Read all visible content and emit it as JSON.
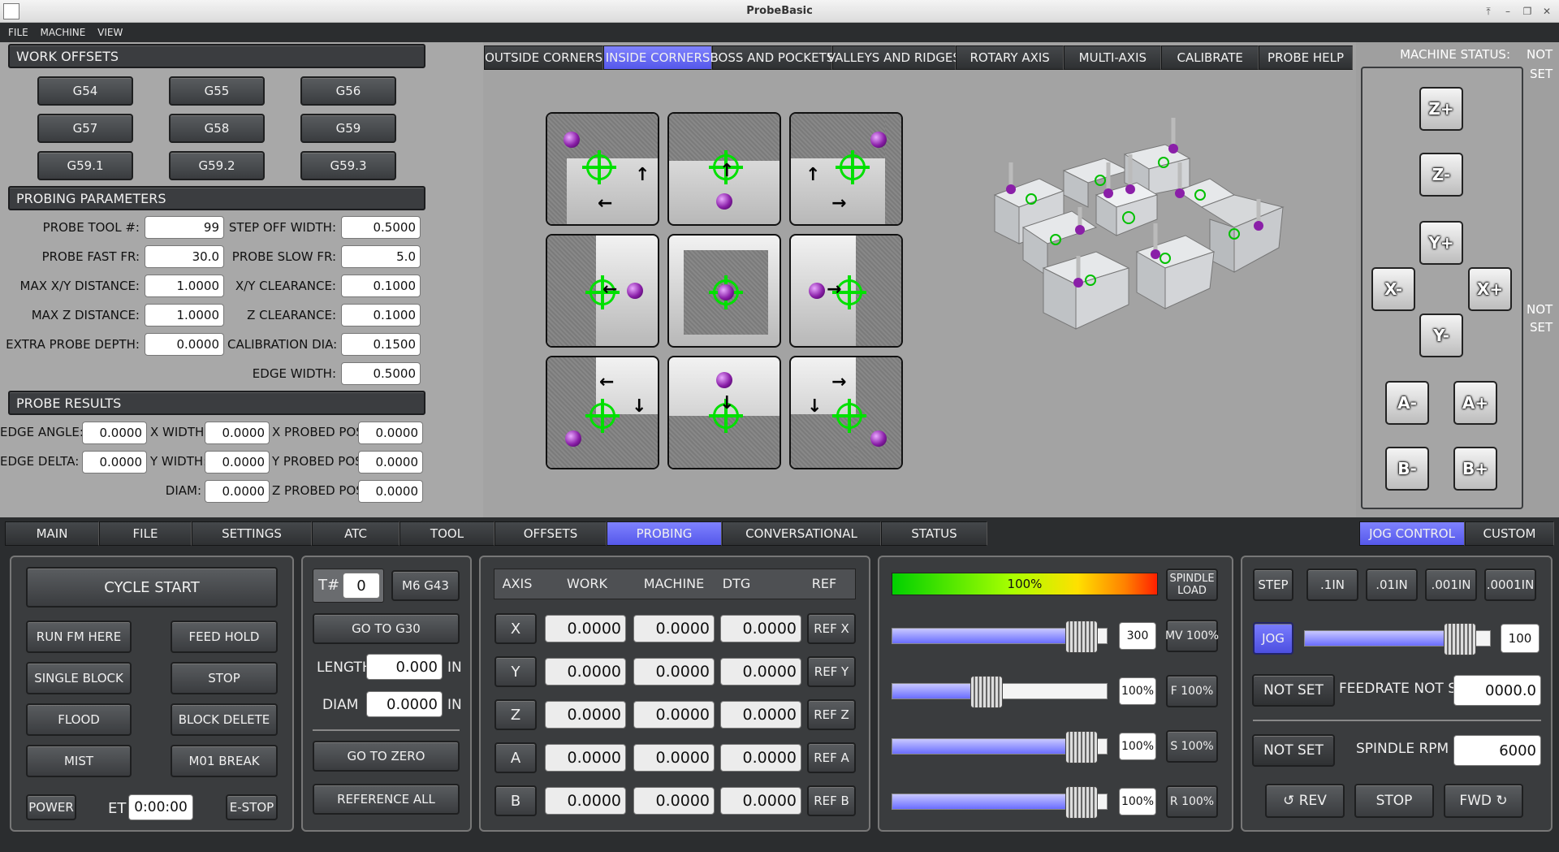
{
  "window": {
    "title": "ProbeBasic"
  },
  "menu": [
    "FILE",
    "MACHINE",
    "VIEW"
  ],
  "work_offsets": {
    "title": "WORK OFFSETS",
    "buttons": [
      "G54",
      "G55",
      "G56",
      "G57",
      "G58",
      "G59",
      "G59.1",
      "G59.2",
      "G59.3"
    ]
  },
  "probing_parameters": {
    "title": "PROBING PARAMETERS",
    "left": [
      {
        "label": "PROBE TOOL #:",
        "value": "99"
      },
      {
        "label": "PROBE FAST FR:",
        "value": "30.0"
      },
      {
        "label": "MAX X/Y DISTANCE:",
        "value": "1.0000"
      },
      {
        "label": "MAX Z DISTANCE:",
        "value": "1.0000"
      },
      {
        "label": "EXTRA PROBE DEPTH:",
        "value": "0.0000"
      }
    ],
    "right": [
      {
        "label": "STEP OFF WIDTH:",
        "value": "0.5000"
      },
      {
        "label": "PROBE SLOW FR:",
        "value": "5.0"
      },
      {
        "label": "X/Y CLEARANCE:",
        "value": "0.1000"
      },
      {
        "label": "Z CLEARANCE:",
        "value": "0.1000"
      },
      {
        "label": "CALIBRATION DIA:",
        "value": "0.1500"
      },
      {
        "label": "EDGE WIDTH:",
        "value": "0.5000"
      }
    ]
  },
  "probe_results": {
    "title": "PROBE RESULTS",
    "edge_angle": {
      "label": "EDGE ANGLE:",
      "value": "0.0000"
    },
    "edge_delta": {
      "label": "EDGE DELTA:",
      "value": "0.0000"
    },
    "x_width": {
      "label": "X WIDTH:",
      "value": "0.0000"
    },
    "y_width": {
      "label": "Y WIDTH:",
      "value": "0.0000"
    },
    "diam": {
      "label": "DIAM:",
      "value": "0.0000"
    },
    "x_probed": {
      "label": "X PROBED POS:",
      "value": "0.0000"
    },
    "y_probed": {
      "label": "Y PROBED POS:",
      "value": "0.0000"
    },
    "z_probed": {
      "label": "Z PROBED POS:",
      "value": "0.0000"
    }
  },
  "probe_tabs": [
    "OUTSIDE CORNERS",
    "INSIDE CORNERS",
    "BOSS AND POCKETS",
    "VALLEYS AND RIDGES",
    "ROTARY AXIS",
    "MULTI-AXIS",
    "CALIBRATE",
    "PROBE HELP"
  ],
  "probe_tab_active": "INSIDE CORNERS",
  "machine_status": {
    "label": "MACHINE STATUS:",
    "not": "NOT",
    "set": "SET",
    "not2": "NOT",
    "set2": "SET"
  },
  "jog_pad": {
    "zp": "Z+",
    "zm": "Z-",
    "yp": "Y+",
    "ym": "Y-",
    "xm": "X-",
    "xp": "X+",
    "am": "A-",
    "ap": "A+",
    "bm": "B-",
    "bp": "B+"
  },
  "main_tabs": [
    "MAIN",
    "FILE",
    "SETTINGS",
    "ATC",
    "TOOL",
    "OFFSETS",
    "PROBING",
    "CONVERSATIONAL",
    "STATUS"
  ],
  "main_tab_active": "PROBING",
  "right_tabs": [
    "JOG CONTROL",
    "CUSTOM"
  ],
  "cycle": {
    "cycle_start": "CYCLE START",
    "run_fm_here": "RUN FM HERE",
    "feed_hold": "FEED HOLD",
    "single_block": "SINGLE BLOCK",
    "stop": "STOP",
    "flood": "FLOOD",
    "block_delete": "BLOCK DELETE",
    "mist": "MIST",
    "m01_break": "M01 BREAK",
    "power": "POWER",
    "et_label": "ET",
    "et_value": "0:00:00",
    "estop": "E-STOP"
  },
  "tool": {
    "t_label": "T#",
    "t_value": "0",
    "m6g43": "M6 G43",
    "go_g30": "GO TO G30",
    "length_label": "LENGTH",
    "length_value": "0.000",
    "diam_label": "DIAM",
    "diam_value": "0.0000",
    "unit": "IN",
    "go_zero": "GO TO ZERO",
    "ref_all": "REFERENCE ALL"
  },
  "dro": {
    "headers": [
      "AXIS",
      "WORK",
      "MACHINE",
      "DTG",
      "REF"
    ],
    "rows": [
      {
        "axis": "X",
        "work": "0.0000",
        "machine": "0.0000",
        "dtg": "0.0000",
        "ref": "REF X"
      },
      {
        "axis": "Y",
        "work": "0.0000",
        "machine": "0.0000",
        "dtg": "0.0000",
        "ref": "REF Y"
      },
      {
        "axis": "Z",
        "work": "0.0000",
        "machine": "0.0000",
        "dtg": "0.0000",
        "ref": "REF Z"
      },
      {
        "axis": "A",
        "work": "0.0000",
        "machine": "0.0000",
        "dtg": "0.0000",
        "ref": "REF A"
      },
      {
        "axis": "B",
        "work": "0.0000",
        "machine": "0.0000",
        "dtg": "0.0000",
        "ref": "REF B"
      }
    ]
  },
  "overrides": {
    "spindle_load": "100%",
    "spindle_load_label1": "SPINDLE",
    "spindle_load_label2": "LOAD",
    "sliders": [
      {
        "value": "300",
        "btn": "MV 100%",
        "level": 0.87
      },
      {
        "value": "100%",
        "btn": "F 100%",
        "level": 0.43
      },
      {
        "value": "100%",
        "btn": "S 100%",
        "level": 0.87
      },
      {
        "value": "100%",
        "btn": "R 100%",
        "level": 0.87
      }
    ]
  },
  "jog_control": {
    "step": "STEP",
    "steps": [
      ".1IN",
      ".01IN",
      ".001IN",
      ".0001IN"
    ],
    "jog": "JOG",
    "jog_value": "100",
    "jog_level": 0.82,
    "not_set_1": "NOT SET",
    "feedrate_label": "FEEDRATE NOT SET/",
    "feedrate_value": "0000.0",
    "not_set_2": "NOT SET",
    "spindle_rpm_label": "SPINDLE RPM",
    "spindle_rpm_value": "6000",
    "rev": "↺ REV",
    "stop": "STOP",
    "fwd": "FWD ↻"
  },
  "colors": {
    "accent": "#5b5ef0",
    "target": "#00e000",
    "ball": "#8a1fa8"
  }
}
